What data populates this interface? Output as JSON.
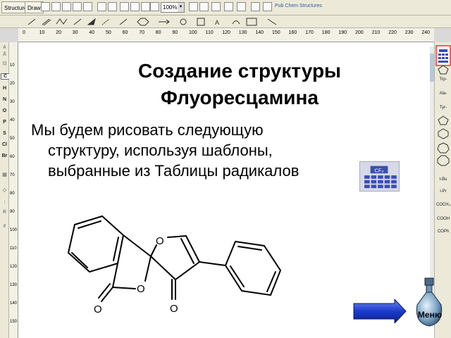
{
  "toolbar": {
    "tab_structure": "Structure",
    "tab_draw": "Draw",
    "zoom_value": "100%",
    "brand": "Pub Chem Structures"
  },
  "rulers": {
    "top_ticks": [
      "0",
      "10",
      "20",
      "30",
      "40",
      "50",
      "60",
      "70",
      "80",
      "90",
      "100",
      "110",
      "120",
      "130",
      "140",
      "150",
      "160",
      "170",
      "180",
      "190",
      "200",
      "210",
      "220",
      "230",
      "240"
    ],
    "left_ticks": [
      "10",
      "20",
      "30",
      "40",
      "50",
      "60",
      "70",
      "80",
      "90",
      "100",
      "110",
      "120",
      "130",
      "140",
      "150"
    ]
  },
  "left_palette": {
    "elements": [
      "C",
      "H",
      "N",
      "O",
      "P",
      "S",
      "Cl",
      "Br"
    ]
  },
  "right_palette": {
    "items": [
      "Trp-",
      "Ala-",
      "Tyr-",
      "t-Bu",
      "i-Pr",
      "COCH₃",
      "COOH",
      "COPh"
    ]
  },
  "slide": {
    "title_line1": "Создание структуры",
    "title_line2": "Флуоресцамина",
    "body_line1": "Мы будем рисовать следующую",
    "body_line2": "структуру, используя шаблоны,",
    "body_line3": "выбранные из Таблицы радикалов"
  },
  "radical_table_icon": {
    "label": "CF₃"
  },
  "molecule": {
    "atom_labels": [
      "O",
      "O",
      "O",
      "O"
    ]
  },
  "navigation": {
    "menu_label": "Меню"
  }
}
